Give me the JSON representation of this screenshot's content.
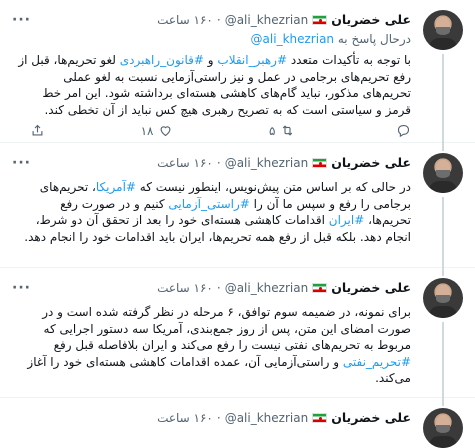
{
  "tweets": [
    {
      "name": "علی خضریان",
      "handle": "@ali_khezrian",
      "dot": "·",
      "time": "۱۶۰ ساعت",
      "reply_to_prefix": "درحال پاسخ به",
      "reply_to_handle": "@ali_khezrian",
      "segments": [
        {
          "t": "با توجه به تأکیدات متعدد "
        },
        {
          "t": "#رهبر_انقلاب",
          "tag": true
        },
        {
          "t": " و "
        },
        {
          "t": "#قانون_راهبردی",
          "tag": true
        },
        {
          "t": " لغو تحریم‌ها، قبل از رفع تحریم‌های برجامی در عمل و نیز راستی‌آزمایی نسبت به لغو عملی تحریم‌های مذکور، نباید گام‌های کاهشی هسته‌ای برداشته شود. این امر خط قرمز و سیاستی است که به تصریح رهبری هیچ کس نباید از آن تخطی کند."
        }
      ],
      "reply_count": "",
      "retweet_count": "۵",
      "like_count": "۱۸",
      "show_counts": true
    },
    {
      "name": "علی خضریان",
      "handle": "@ali_khezrian",
      "dot": "·",
      "time": "۱۶۰ ساعت",
      "segments": [
        {
          "t": "در حالی که بر اساس متن پیش‌نویس، اینطور نیست که "
        },
        {
          "t": "#آمریکا",
          "tag": true
        },
        {
          "t": "، تحریم‌های برجامی را رفع و سپس ما آن را "
        },
        {
          "t": "#راستی_آزمایی",
          "tag": true
        },
        {
          "t": " کنیم و در صورت رفع تحریم‌ها، "
        },
        {
          "t": "#ایران",
          "tag": true
        },
        {
          "t": " اقدامات کاهشی هسته‌ای خود را بعد از تحقق آن دو شرط، انجام دهد. بلکه قبل از رفع همه تحریم‌ها، ایران باید اقدامات خود را انجام دهد."
        }
      ],
      "show_counts": false
    },
    {
      "name": "علی خضریان",
      "handle": "@ali_khezrian",
      "dot": "·",
      "time": "۱۶۰ ساعت",
      "segments": [
        {
          "t": "برای نمونه، در ضمیمه سوم توافق، ۶ مرحله در نظر گرفته شده است و در صورت امضای این متن، پس از روز جمع‌بندی، آمریکا سه دستور اجرایی که مربوط به تحریم‌های نفتی نیست را رفع می‌کند و ایران بلافاصله قبل رفع "
        },
        {
          "t": "#تحریم_نفتی",
          "tag": true
        },
        {
          "t": " و راستی‌آزمایی آن، عمده اقدامات کاهشی هسته‌ای خود را آغاز می‌کند."
        }
      ],
      "show_counts": false
    },
    {
      "name": "علی خضریان",
      "handle": "@ali_khezrian",
      "dot": "·",
      "time": "۱۶۰ ساعت",
      "segments": [],
      "show_counts": false
    }
  ],
  "icons": {
    "reply": "reply-icon",
    "retweet": "retweet-icon",
    "like": "heart-icon",
    "share": "share-icon",
    "more": "more-icon",
    "flag": "iran-flag-icon"
  },
  "colors": {
    "link": "#1d9bf0",
    "muted": "#536471",
    "text": "#0f1419"
  }
}
